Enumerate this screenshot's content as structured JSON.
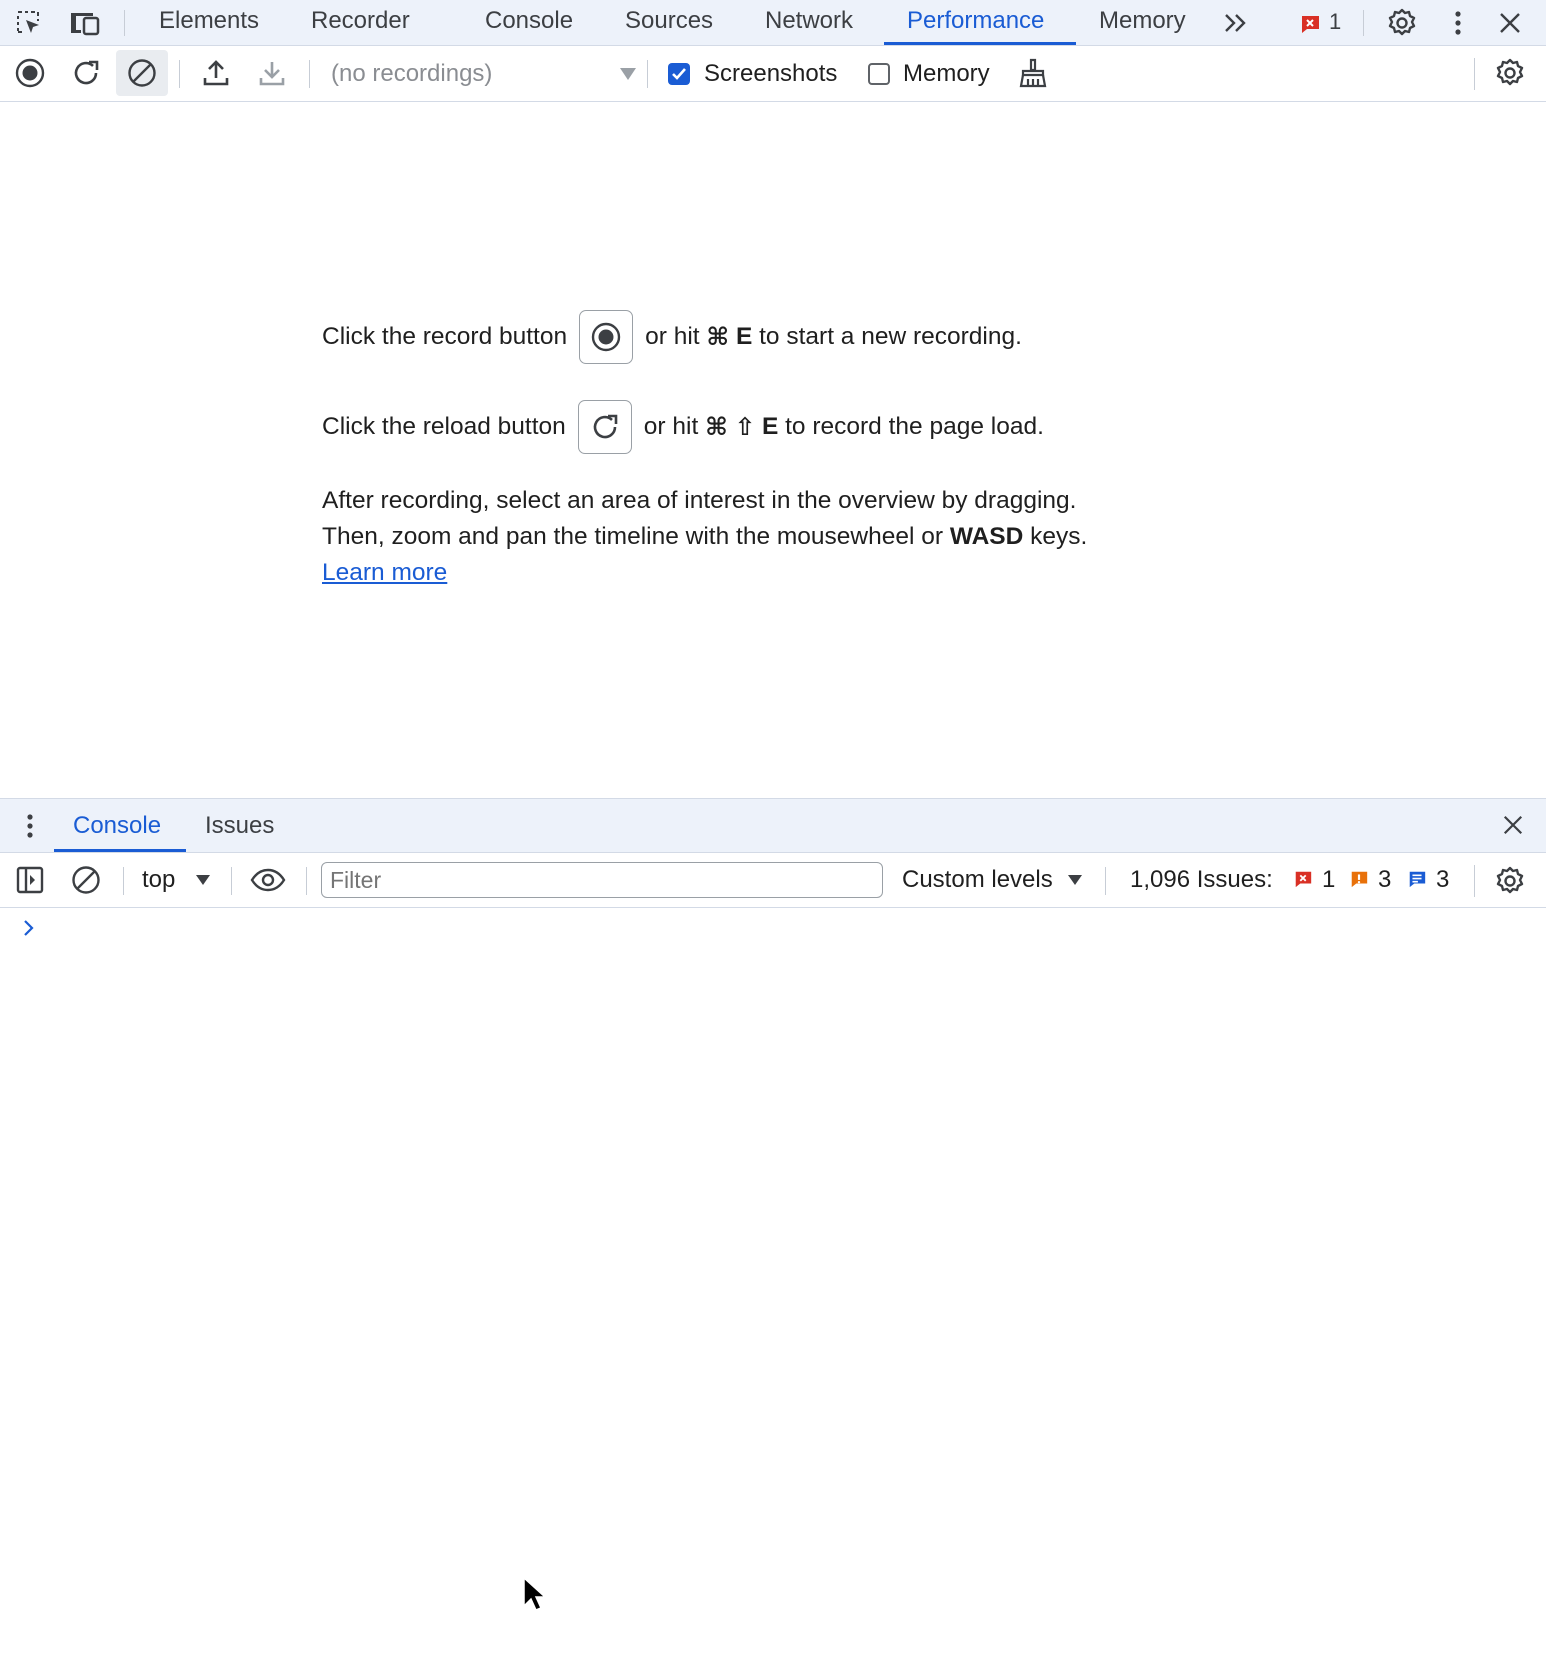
{
  "devtools_tabs": {
    "items": [
      "Elements",
      "Recorder",
      "Console",
      "Sources",
      "Network",
      "Performance",
      "Memory"
    ],
    "active": "Performance",
    "error_count": "1"
  },
  "perf_toolbar": {
    "recordings_placeholder": "(no recordings)",
    "screenshots_label": "Screenshots",
    "screenshots_checked": true,
    "memory_label": "Memory",
    "memory_checked": false
  },
  "landing": {
    "record_before": "Click the record button",
    "record_after_1": "or hit",
    "record_key_cmd": "⌘",
    "record_key": "E",
    "record_after_2": "to start a new recording.",
    "reload_before": "Click the reload button",
    "reload_after_1": "or hit",
    "reload_key_cmd": "⌘",
    "reload_key_shift": "⇧",
    "reload_key": "E",
    "reload_after_2": "to record the page load.",
    "after_line1": "After recording, select an area of interest in the overview by dragging.",
    "after_line2_a": "Then, zoom and pan the timeline with the mousewheel or",
    "after_line2_b": "WASD",
    "after_line2_c": "keys.",
    "learn_more": "Learn more"
  },
  "drawer": {
    "tabs": [
      "Console",
      "Issues"
    ],
    "active": "Console"
  },
  "console_toolbar": {
    "context": "top",
    "filter_placeholder": "Filter",
    "levels": "Custom levels",
    "issues_label": "1,096 Issues:",
    "errors": "1",
    "warnings": "3",
    "info": "3"
  },
  "colors": {
    "accent": "#1a5cd4",
    "error": "#d93025",
    "warning": "#e8710a",
    "info": "#1a5cd4"
  }
}
